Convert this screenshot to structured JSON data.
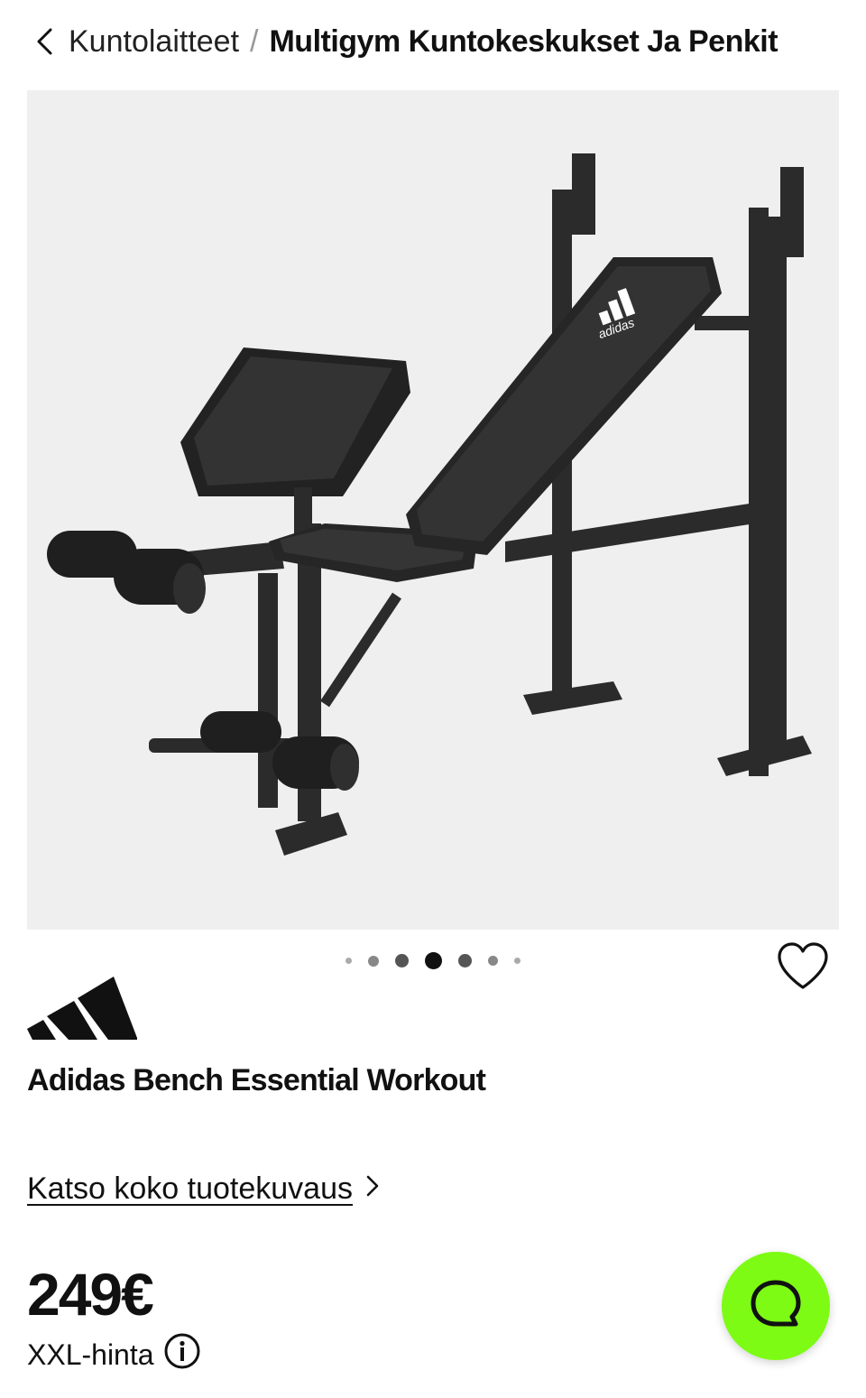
{
  "breadcrumb": {
    "parent": "Kuntolaitteet",
    "separator": "/",
    "current": "Multigym Kuntokeskukset Ja Penkit",
    "back_icon": "chevron-left-icon"
  },
  "gallery": {
    "image_description_icon": "product-image",
    "image_logo_text": "adidas",
    "slide_count": 7,
    "active_slide": 4,
    "favorite_icon": "heart-outline-icon",
    "background": "#efefef"
  },
  "product": {
    "brand_logo_icon": "adidas-logo",
    "title": "Adidas Bench Essential Workout",
    "description_link": "Katso koko tuotekuvaus",
    "description_link_icon": "chevron-right-icon",
    "price": "249€",
    "price_label": "XXL-hinta",
    "price_info_icon": "info-icon"
  },
  "chat": {
    "icon": "chat-bubble-icon",
    "color": "#7dfb14"
  }
}
